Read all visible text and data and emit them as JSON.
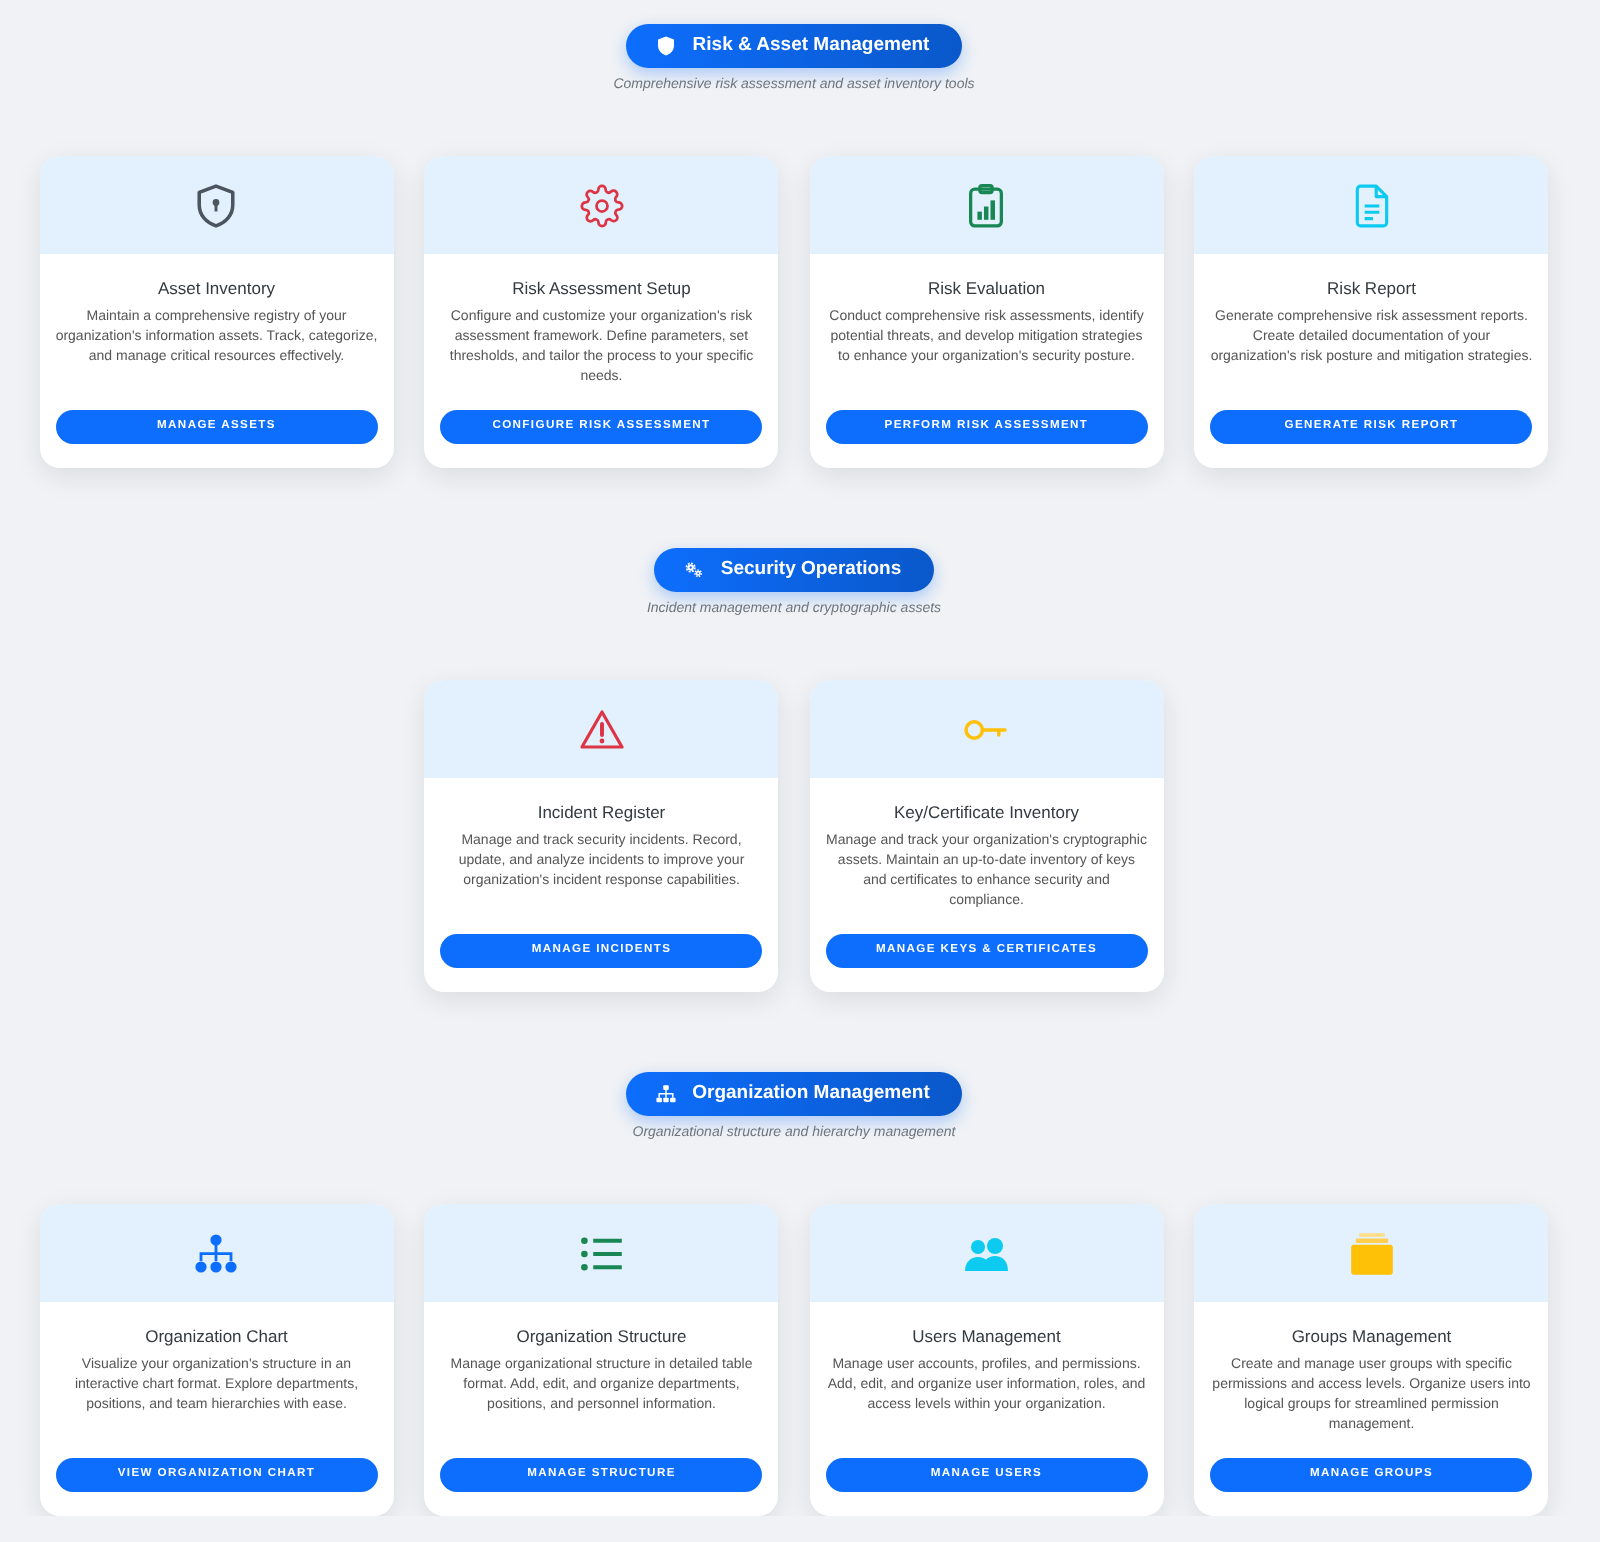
{
  "sections": [
    {
      "kind": "shield",
      "title": "Risk & Asset Management",
      "subtitle": "Comprehensive risk assessment and asset inventory tools",
      "cards": [
        {
          "kind": "shield",
          "title": "Asset Inventory",
          "description": "Maintain a comprehensive registry of your organization's information assets. Track, categorize, and manage critical resources effectively.",
          "button": "MANAGE ASSETS"
        },
        {
          "kind": "gear",
          "title": "Risk Assessment Setup",
          "description": "Configure and customize your organization's risk assessment framework. Define parameters, set thresholds, and tailor the process to your specific needs.",
          "button": "CONFIGURE RISK ASSESSMENT"
        },
        {
          "kind": "clipboard",
          "title": "Risk Evaluation",
          "description": "Conduct comprehensive risk assessments, identify potential threats, and develop mitigation strategies to enhance your organization's security posture.",
          "button": "PERFORM RISK ASSESSMENT"
        },
        {
          "kind": "document",
          "title": "Risk Report",
          "description": "Generate comprehensive risk assessment reports. Create detailed documentation of your organization's risk posture and mitigation strategies.",
          "button": "GENERATE RISK REPORT"
        }
      ]
    },
    {
      "kind": "gears",
      "title": "Security Operations",
      "subtitle": "Incident management and cryptographic assets",
      "cards": [
        {
          "kind": "warning",
          "title": "Incident Register",
          "description": "Manage and track security incidents. Record, update, and analyze incidents to improve your organization's incident response capabilities.",
          "button": "MANAGE INCIDENTS"
        },
        {
          "kind": "key",
          "title": "Key/Certificate Inventory",
          "description": "Manage and track your organization's cryptographic assets. Maintain an up-to-date inventory of keys and certificates to enhance security and compliance.",
          "button": "MANAGE KEYS & CERTIFICATES"
        }
      ]
    },
    {
      "kind": "hierarchy",
      "title": "Organization Management",
      "subtitle": "Organizational structure and hierarchy management",
      "cards": [
        {
          "kind": "hierarchy",
          "title": "Organization Chart",
          "description": "Visualize your organization's structure in an interactive chart format. Explore departments, positions, and team hierarchies with ease.",
          "button": "VIEW ORGANIZATION CHART"
        },
        {
          "kind": "list",
          "title": "Organization Structure",
          "description": "Manage organizational structure in detailed table format. Add, edit, and organize departments, positions, and personnel information.",
          "button": "MANAGE STRUCTURE"
        },
        {
          "kind": "users",
          "title": "Users Management",
          "description": "Manage user accounts, profiles, and permissions. Add, edit, and organize user information, roles, and access levels within your organization.",
          "button": "MANAGE USERS"
        },
        {
          "kind": "folder",
          "title": "Groups Management",
          "description": "Create and manage user groups with specific permissions and access levels. Organize users into logical groups for streamlined permission management.",
          "button": "MANAGE GROUPS"
        }
      ]
    }
  ]
}
